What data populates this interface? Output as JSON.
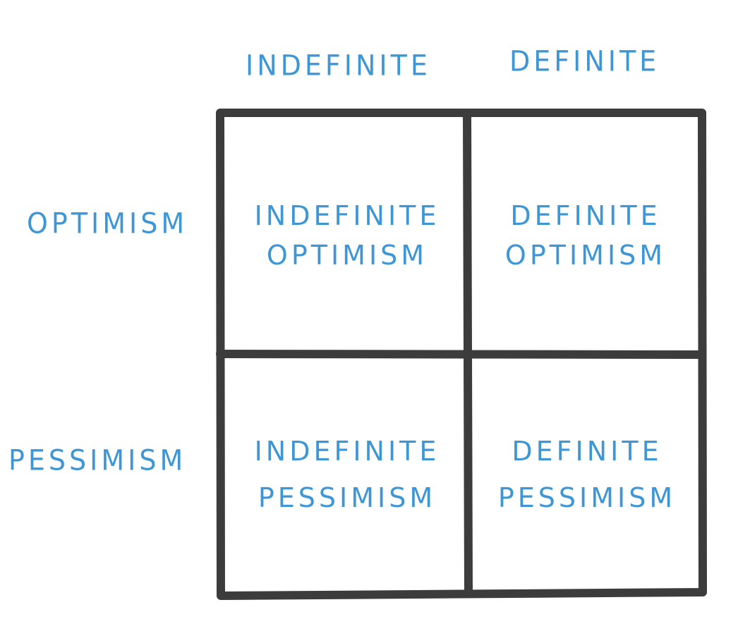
{
  "columns": {
    "indefinite": "INDEFINITE",
    "definite": "DEFINITE"
  },
  "rows": {
    "optimism": "OPTIMISM",
    "pessimism": "PESSIMISM"
  },
  "cells": {
    "indefinite_optimism": {
      "line1": "INDEFINITE",
      "line2": "OPTIMISM"
    },
    "definite_optimism": {
      "line1": "DEFINITE",
      "line2": "OPTIMISM"
    },
    "indefinite_pessimism": {
      "line1": "INDEFINITE",
      "line2": "PESSIMISM"
    },
    "definite_pessimism": {
      "line1": "DEFINITE",
      "line2": "PESSIMISM"
    }
  },
  "colors": {
    "text": "#3d96d6",
    "grid": "#3c3c3c",
    "background": "#ffffff"
  }
}
